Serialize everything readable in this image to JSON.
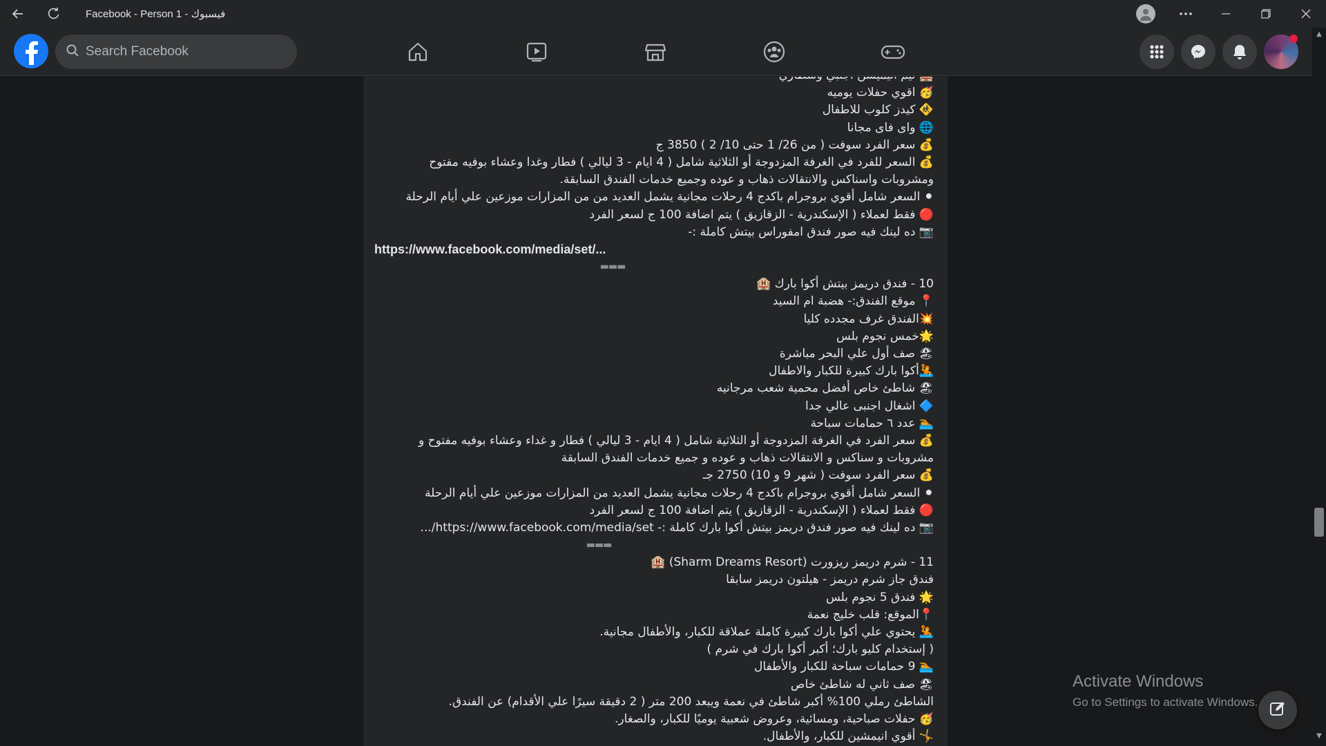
{
  "window": {
    "title": "Facebook - Person 1 - فيسبوك"
  },
  "header": {
    "search_placeholder": "Search Facebook",
    "nav": [
      "home-icon",
      "watch-icon",
      "marketplace-icon",
      "groups-icon",
      "gaming-icon"
    ],
    "right": [
      "menu-grid-icon",
      "messenger-icon",
      "notifications-icon",
      "account-avatar"
    ]
  },
  "post": {
    "lines": [
      "🏨 تيم انيميشن اجنبي وشطاري",
      "🥳 اقوي حفلات يوميه",
      "🚸 كيدز كلوب للاطفال",
      "🌐 واى فاى مجانا",
      "💰 سعر الفرد سوفت ( من  26/ 1 حتى 10/ 2 ) 3850 ج",
      "💰 السعر للفرد في الغرفة المزدوجة أو الثلاثية شامل ( 4 ايام - 3 ليالي ) فطار وغدا وعشاء بوفيه مفتوح",
      "ومشروبات واسناكس والانتقالات ذهاب و عوده وجميع خدمات الفندق السابقة.",
      "⚫ السعر شامل أقوي بروجرام باكدج 4 رحلات مجانية يشمل العديد من من المزارات موزعين علي أيام الرحلة",
      "🔴 فقط لعملاء ( الإسكندرية - الزقازيق ) يتم اضافة 100 ج لسعر الفرد",
      "📷 ده لينك فيه صور فندق امفوراس بيتش كاملة :-",
      "https://www.facebook.com/media/set/...",
      "▬▬▬",
      "10 - فندق دريمز بيتش أكوا بارك 🏨",
      "📍 موقع الفندق:- هضبة ام السيد",
      "💥الفندق غرف مجدده كليا",
      "🌟خمس نجوم بلس",
      "🏖 صف أول علي البحر  مباشرة",
      "🤽أكوا بارك كبيرة للكبار والاطفال",
      "🏖 شاطئ خاص أفضل محمية شعب مرجانيه",
      "🔷 اشغال اجنبى عالي جدا",
      "🏊 عدد ٦ حمامات سباحة",
      "💰 سعر الفرد  في الغرفة المزدوجة أو الثلاثية  شامل ( 4 ايام - 3 ليالي ) فطار و غداء  وعشاء بوفيه مفتوح و",
      "مشروبات و سناكس و الانتقالات ذهاب و عوده و جميع خدمات الفندق السابقة",
      "💰 سعر الفرد سوفت ( شهر 9 و 10) 2750 جـ",
      "⚫ السعر شامل أقوي بروجرام باكدج 4 رحلات مجانية يشمل العديد من المزارات موزعين علي أيام الرحلة",
      "🔴 فقط لعملاء ( الإسكندرية - الزقازيق ) يتم اضافة 100 ج لسعر الفرد",
      "📷 ده لينك فيه صور  فندق دريمز بيتش أكوا بارك  كاملة :- https://www.facebook.com/media/set/...",
      "▬▬▬",
      "11 - شرم دريمز ريزورت  (Sharm Dreams Resort) 🏨",
      "فندق جاز شرم دريمز - هيلتون دريمز سابقا",
      "🌟 فندق 5 نجوم بلس",
      "📍الموقع: قلب خليج نعمة",
      "🤽 يحتوي علي أكوا بارك كبيرة كاملة عملاقة للكبار، والأطفال مجانية.",
      "( إستخدام كليو بارك؛ أكبر أكوا بارك في شرم )",
      "🏊 9 حمامات سباحة للكبار والأطفال",
      "🏖 صف ثاني له شاطئ خاص",
      "الشاطئ رملي 100% أكبر شاطئ في نعمة ويبعد 200 متر ( 2 دقيقة سيرًا علي الأقدام) عن الفندق.",
      "🥳 حفلات صباحية، ومسائية، وعروض شعبية يوميًا للكبار، والصغار.",
      "🤸 أقوي انيمشين للكبار، والأطفال."
    ]
  },
  "watermark": {
    "title": "Activate Windows",
    "subtitle": "Go to Settings to activate Windows."
  },
  "colors": {
    "background": "#18191a",
    "surface": "#242526",
    "brand": "#1877f2"
  }
}
